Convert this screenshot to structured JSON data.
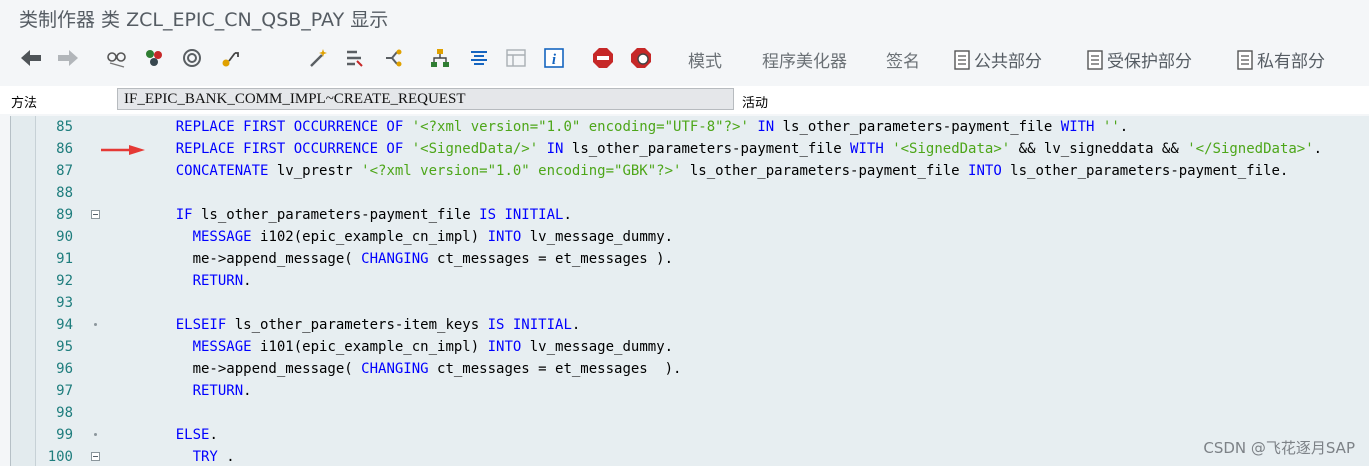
{
  "window": {
    "title": "类制作器 类 ZCL_EPIC_CN_QSB_PAY 显示"
  },
  "toolbar": {
    "icons": [
      "back-arrow-icon",
      "forward-arrow-icon",
      "glasses-icon",
      "activate-icon",
      "where-used-icon",
      "transport-icon",
      "magic-wand-icon",
      "find-icon",
      "tree-icon",
      "hierarchy-icon",
      "stack-icon",
      "table-icon",
      "info-icon",
      "stop-breakpoint-icon",
      "watch-breakpoint-icon"
    ],
    "text_buttons": {
      "mode": "模式",
      "pretty_printer": "程序美化器",
      "signature": "签名",
      "public_section": "公共部分",
      "protected_section": "受保护部分",
      "private_section": "私有部分"
    }
  },
  "method_row": {
    "label": "方法",
    "value": "IF_EPIC_BANK_COMM_IMPL~CREATE_REQUEST",
    "status": "活动"
  },
  "editor": {
    "colors": {
      "keyword": "#0000ff",
      "string": "#4da619",
      "line_number": "#1e7d7d",
      "arrow": "#e53935",
      "background": "#e7eef1"
    },
    "lines": [
      {
        "num": "85",
        "marker": "none",
        "tokens": [
          {
            "t": "    "
          },
          {
            "t": "REPLACE FIRST OCCURRENCE OF",
            "c": "kw"
          },
          {
            "t": " "
          },
          {
            "t": "'<?xml version=\"1.0\" encoding=\"UTF-8\"?>'",
            "c": "str"
          },
          {
            "t": " "
          },
          {
            "t": "IN",
            "c": "kw"
          },
          {
            "t": " ls_other_parameters-payment_file "
          },
          {
            "t": "WITH",
            "c": "kw"
          },
          {
            "t": " "
          },
          {
            "t": "''",
            "c": "str"
          },
          {
            "t": "."
          }
        ]
      },
      {
        "num": "86",
        "marker": "arrow",
        "tokens": [
          {
            "t": "    "
          },
          {
            "t": "REPLACE FIRST OCCURRENCE OF",
            "c": "kw"
          },
          {
            "t": " "
          },
          {
            "t": "'<SignedData/>'",
            "c": "str"
          },
          {
            "t": " "
          },
          {
            "t": "IN",
            "c": "kw"
          },
          {
            "t": " ls_other_parameters-payment_file "
          },
          {
            "t": "WITH",
            "c": "kw"
          },
          {
            "t": " "
          },
          {
            "t": "'<SignedData>'",
            "c": "str"
          },
          {
            "t": " && lv_signeddata && "
          },
          {
            "t": "'</SignedData>'",
            "c": "str"
          },
          {
            "t": "."
          }
        ]
      },
      {
        "num": "87",
        "marker": "none",
        "tokens": [
          {
            "t": "    "
          },
          {
            "t": "CONCATENATE",
            "c": "kw"
          },
          {
            "t": " lv_prestr "
          },
          {
            "t": "'<?xml version=\"1.0\" encoding=\"GBK\"?>'",
            "c": "str"
          },
          {
            "t": " ls_other_parameters-payment_file "
          },
          {
            "t": "INTO",
            "c": "kw"
          },
          {
            "t": " ls_other_parameters-payment_file."
          }
        ]
      },
      {
        "num": "88",
        "marker": "none",
        "tokens": []
      },
      {
        "num": "89",
        "marker": "fold",
        "tokens": [
          {
            "t": "    "
          },
          {
            "t": "IF",
            "c": "kw"
          },
          {
            "t": " ls_other_parameters-payment_file "
          },
          {
            "t": "IS INITIAL",
            "c": "kw"
          },
          {
            "t": "."
          }
        ]
      },
      {
        "num": "90",
        "marker": "none",
        "tokens": [
          {
            "t": "      "
          },
          {
            "t": "MESSAGE",
            "c": "kw"
          },
          {
            "t": " i102(epic_example_cn_impl) "
          },
          {
            "t": "INTO",
            "c": "kw"
          },
          {
            "t": " lv_message_dummy."
          }
        ]
      },
      {
        "num": "91",
        "marker": "none",
        "tokens": [
          {
            "t": "      me->append_message( "
          },
          {
            "t": "CHANGING",
            "c": "kw"
          },
          {
            "t": " ct_messages = et_messages )."
          }
        ]
      },
      {
        "num": "92",
        "marker": "none",
        "tokens": [
          {
            "t": "      "
          },
          {
            "t": "RETURN",
            "c": "kw"
          },
          {
            "t": "."
          }
        ]
      },
      {
        "num": "93",
        "marker": "none",
        "tokens": []
      },
      {
        "num": "94",
        "marker": "dot",
        "tokens": [
          {
            "t": "    "
          },
          {
            "t": "ELSEIF",
            "c": "kw"
          },
          {
            "t": " ls_other_parameters-item_keys "
          },
          {
            "t": "IS INITIAL",
            "c": "kw"
          },
          {
            "t": "."
          }
        ]
      },
      {
        "num": "95",
        "marker": "none",
        "tokens": [
          {
            "t": "      "
          },
          {
            "t": "MESSAGE",
            "c": "kw"
          },
          {
            "t": " i101(epic_example_cn_impl) "
          },
          {
            "t": "INTO",
            "c": "kw"
          },
          {
            "t": " lv_message_dummy."
          }
        ]
      },
      {
        "num": "96",
        "marker": "none",
        "tokens": [
          {
            "t": "      me->append_message( "
          },
          {
            "t": "CHANGING",
            "c": "kw"
          },
          {
            "t": " ct_messages = et_messages  )."
          }
        ]
      },
      {
        "num": "97",
        "marker": "none",
        "tokens": [
          {
            "t": "      "
          },
          {
            "t": "RETURN",
            "c": "kw"
          },
          {
            "t": "."
          }
        ]
      },
      {
        "num": "98",
        "marker": "none",
        "tokens": []
      },
      {
        "num": "99",
        "marker": "dot",
        "tokens": [
          {
            "t": "    "
          },
          {
            "t": "ELSE",
            "c": "kw"
          },
          {
            "t": "."
          }
        ]
      },
      {
        "num": "100",
        "marker": "fold",
        "tokens": [
          {
            "t": "      "
          },
          {
            "t": "TRY",
            "c": "kw"
          },
          {
            "t": " ."
          }
        ]
      }
    ]
  },
  "watermark": "CSDN @飞花逐月SAP"
}
